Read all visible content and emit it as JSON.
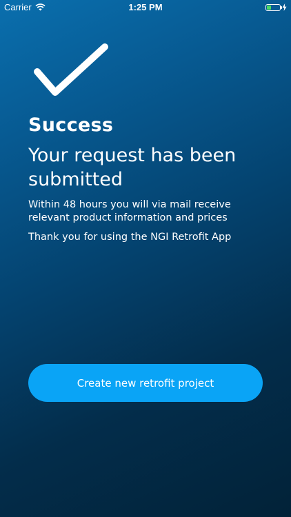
{
  "status_bar": {
    "carrier": "Carrier",
    "time": "1:25 PM",
    "wifi_icon": "wifi-icon",
    "battery_icon": "battery-icon",
    "battery_level_fraction": 0.28,
    "battery_fill_color": "#4cd964",
    "charging_icon": "lightning-bolt-icon"
  },
  "confirmation": {
    "icon": "checkmark-icon",
    "title": "Success",
    "subtitle": "Your request has been submitted",
    "info": "Within 48 hours you will via mail receive relevant product information and prices",
    "thanks": "Thank you for using the NGI Retrofit App"
  },
  "actions": {
    "new_project_label": "Create new retrofit project"
  },
  "colors": {
    "button_background": "#0aa4f6",
    "background_top": "#0a6fae",
    "background_bottom": "#022238",
    "text": "#ffffff"
  }
}
